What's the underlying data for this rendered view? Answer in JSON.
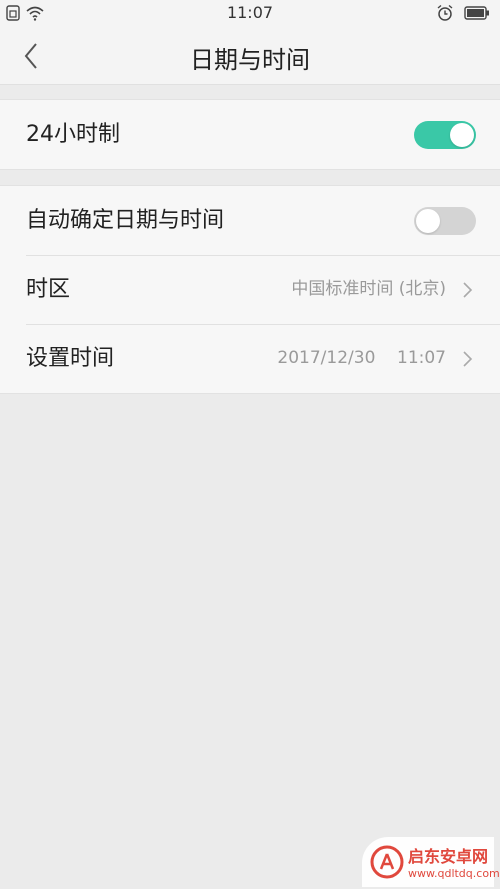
{
  "status_bar": {
    "time": "11:07",
    "left_icons": [
      "sim-icon",
      "wifi-icon"
    ],
    "right_icons": [
      "alarm-icon",
      "battery-icon"
    ]
  },
  "nav": {
    "title": "日期与时间",
    "back_icon": "chevron-left-icon"
  },
  "settings": {
    "hour24": {
      "label": "24小时制",
      "enabled": true
    },
    "auto_datetime": {
      "label": "自动确定日期与时间",
      "enabled": false
    },
    "timezone": {
      "label": "时区",
      "value": "中国标准时间 (北京)"
    },
    "set_time": {
      "label": "设置时间",
      "value": "2017/12/30    11:07"
    }
  },
  "colors": {
    "accent": "#3ac8a7",
    "background": "#ebebeb",
    "row_background": "#f7f7f7",
    "secondary_text": "#9a9a9a"
  },
  "watermark": {
    "name": "启东安卓网",
    "url": "www.qdltdq.com"
  }
}
